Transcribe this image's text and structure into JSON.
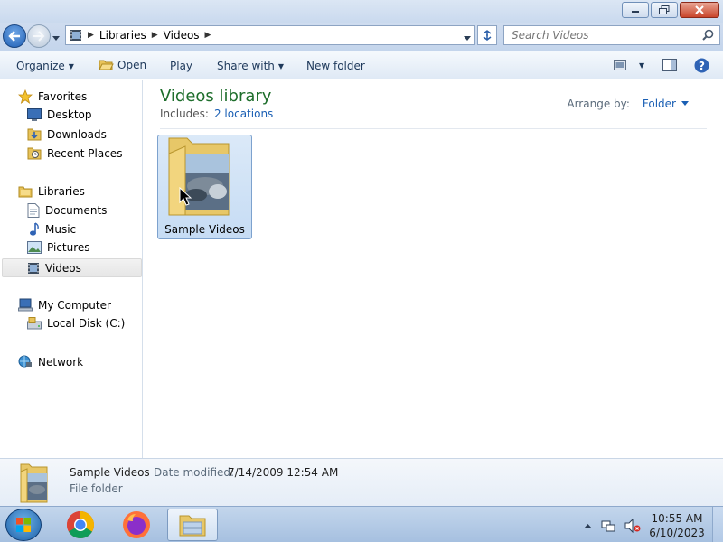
{
  "address": {
    "crumbs": [
      "Libraries",
      "Videos"
    ]
  },
  "search": {
    "placeholder": "Search Videos"
  },
  "toolbar": {
    "organize": "Organize",
    "open": "Open",
    "play": "Play",
    "share_with": "Share with",
    "new_folder": "New folder"
  },
  "nav": {
    "favorites": {
      "label": "Favorites",
      "items": [
        "Desktop",
        "Downloads",
        "Recent Places"
      ]
    },
    "libraries": {
      "label": "Libraries",
      "items": [
        "Documents",
        "Music",
        "Pictures",
        "Videos"
      ]
    },
    "computer": {
      "label": "My Computer",
      "items": [
        "Local Disk (C:)"
      ]
    },
    "network": {
      "label": "Network"
    }
  },
  "content": {
    "title": "Videos library",
    "includes_label": "Includes:",
    "includes_link": "2 locations",
    "arrange_label": "Arrange by:",
    "arrange_value": "Folder",
    "items": [
      {
        "name": "Sample Videos"
      }
    ]
  },
  "details": {
    "name": "Sample Videos",
    "modified_label": "Date modified:",
    "modified_value": "7/14/2009 12:54 AM",
    "type": "File folder"
  },
  "taskbar": {
    "time": "10:55 AM",
    "date": "6/10/2023"
  },
  "colors": {
    "library_title": "#1e6e2c",
    "link": "#1a5fb4",
    "selection": "#c6dcf4"
  }
}
